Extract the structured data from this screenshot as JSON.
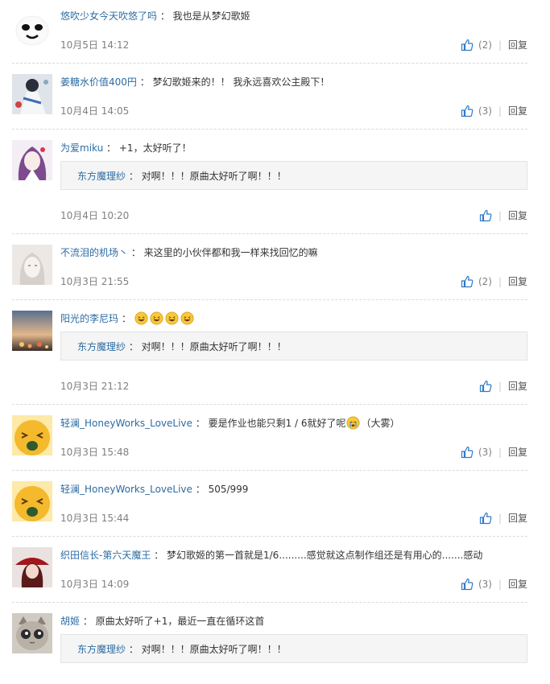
{
  "reply_label": "回复",
  "colors": {
    "user": "#2b6ca3",
    "meta": "#808080",
    "like_icon": "#2f79c7",
    "reply_bg": "#f5f5f5"
  },
  "comments": [
    {
      "user": "悠吹少女今天吹悠了吗",
      "text": "我也是从梦幻歌姬",
      "time": "10月5日 14:12",
      "likes": "(2)",
      "avatar_icon": "white-face-avatar"
    },
    {
      "user": "姜糖水价值400円",
      "text": "梦幻歌姬来的！！ 我永远喜欢公主殿下！",
      "time": "10月4日 14:05",
      "likes": "(3)",
      "avatar_icon": "anime-girl-avatar"
    },
    {
      "user": "为爱miku",
      "text": "+1，太好听了！",
      "time": "10月4日 10:20",
      "likes": "",
      "avatar_icon": "anime-girl-purple-avatar",
      "reply": {
        "user": "东方魔理纱",
        "text": "对啊！！！原曲太好听了啊！！！"
      }
    },
    {
      "user": "不流泪的机场丶",
      "text": "来这里的小伙伴都和我一样来找回忆的嘛",
      "time": "10月3日 21:55",
      "likes": "(2)",
      "avatar_icon": "sketch-girl-avatar"
    },
    {
      "user": "阳光的李尼玛",
      "text": "",
      "emoji": [
        "laughing-emoji",
        "laughing-emoji",
        "laughing-emoji",
        "laughing-emoji"
      ],
      "time": "10月3日 21:12",
      "likes": "",
      "avatar_icon": "sunset-avatar",
      "reply": {
        "user": "东方魔理纱",
        "text": "对啊！！！原曲太好听了啊！！！"
      }
    },
    {
      "user": "轻澜_HoneyWorks_LoveLive",
      "text": "要是作业也能只剩1 / 6就好了呢",
      "text_after": "（大雾）",
      "emoji_inline": "crying-emoji",
      "time": "10月3日 15:48",
      "likes": "(3)",
      "avatar_icon": "yellow-emoji-avatar"
    },
    {
      "user": "轻澜_HoneyWorks_LoveLive",
      "text": "505/999",
      "time": "10月3日 15:44",
      "likes": "",
      "avatar_icon": "yellow-emoji-avatar"
    },
    {
      "user": "织田信长-第六天魔王",
      "text": "梦幻歌姬的第一首就是1/6.........感觉就这点制作组还是有用心的.......感动",
      "time": "10月3日 14:09",
      "likes": "(3)",
      "avatar_icon": "red-hat-avatar"
    },
    {
      "user": "胡姬",
      "text": "原曲太好听了+1，最近一直在循环这首",
      "time": "",
      "likes": "",
      "avatar_icon": "cat-avatar",
      "reply": {
        "user": "东方魔理纱",
        "text": "对啊！！！原曲太好听了啊！！！"
      }
    }
  ]
}
